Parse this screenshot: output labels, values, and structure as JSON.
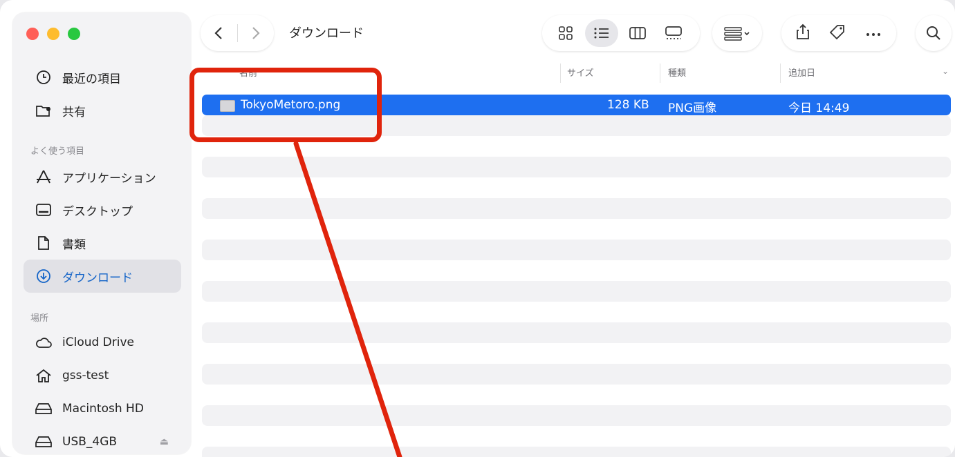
{
  "window": {
    "title": "ダウンロード"
  },
  "sidebar": {
    "items_top": [
      {
        "label": "最近の項目",
        "icon": "clock-icon"
      },
      {
        "label": "共有",
        "icon": "shared-folder-icon"
      }
    ],
    "favorites_heading": "よく使う項目",
    "favorites": [
      {
        "label": "アプリケーション",
        "icon": "applications-icon"
      },
      {
        "label": "デスクトップ",
        "icon": "desktop-icon"
      },
      {
        "label": "書類",
        "icon": "document-icon"
      },
      {
        "label": "ダウンロード",
        "icon": "download-icon",
        "active": true
      }
    ],
    "locations_heading": "場所",
    "locations": [
      {
        "label": "iCloud Drive",
        "icon": "cloud-icon"
      },
      {
        "label": "gss-test",
        "icon": "home-icon"
      },
      {
        "label": "Macintosh HD",
        "icon": "drive-icon"
      },
      {
        "label": "USB_4GB",
        "icon": "drive-icon",
        "eject": "⏏"
      }
    ]
  },
  "toolbar": {
    "back_icon": "chevron-left-icon",
    "forward_icon": "chevron-right-icon",
    "views": [
      "icon-view",
      "list-view",
      "column-view",
      "gallery-view"
    ],
    "selected_view": "list-view",
    "actions": [
      "share-icon",
      "tag-icon",
      "more-icon"
    ],
    "search_icon": "search-icon"
  },
  "columns": {
    "name": "名前",
    "size": "サイズ",
    "kind": "種類",
    "date_added": "追加日"
  },
  "files": [
    {
      "name": "TokyoMetoro.png",
      "size": "128 KB",
      "kind": "PNG画像",
      "date_added": "今日 14:49",
      "selected": true
    }
  ],
  "colors": {
    "accent": "#1e6ff0",
    "annotation": "#e0240c"
  }
}
